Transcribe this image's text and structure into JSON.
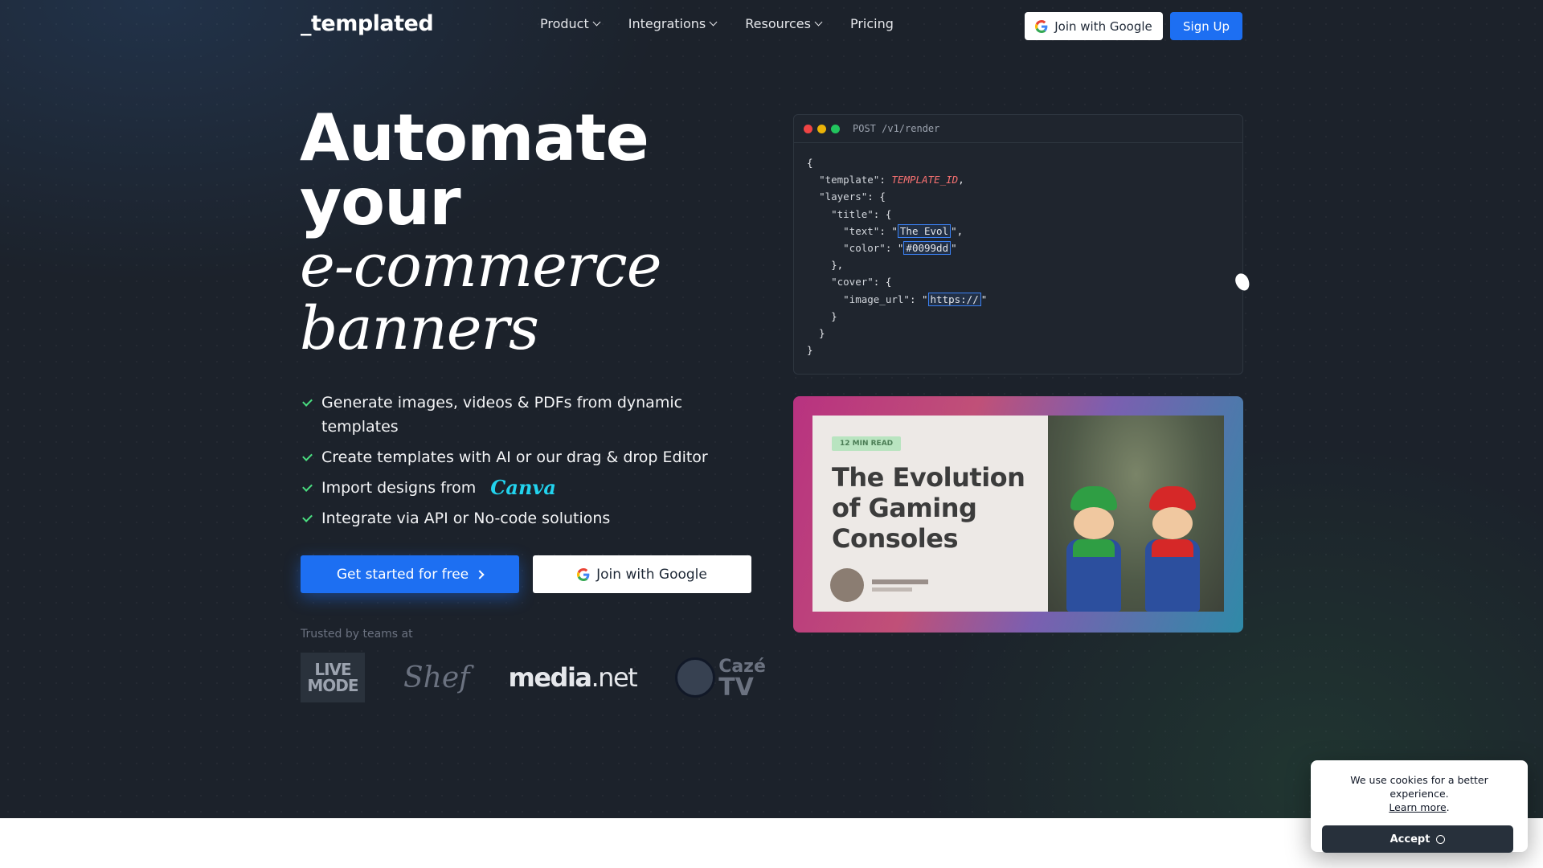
{
  "nav": {
    "logo": "_templated",
    "menu": [
      {
        "label": "Product",
        "has_dropdown": true
      },
      {
        "label": "Integrations",
        "has_dropdown": true
      },
      {
        "label": "Resources",
        "has_dropdown": true
      },
      {
        "label": "Pricing",
        "has_dropdown": false
      }
    ],
    "join_google": "Join with Google",
    "sign_up": "Sign Up"
  },
  "hero": {
    "line1": "Automate",
    "line2": "your",
    "line3": "e-commerce",
    "line4": "banners",
    "features": [
      "Generate images, videos & PDFs from dynamic templates",
      "Create templates with AI or our drag & drop Editor",
      "Import designs from",
      "Integrate via API or No-code solutions"
    ],
    "canva_word": "Canva",
    "cta_primary": "Get started for free",
    "cta_google": "Join with Google",
    "trusted_by": "Trusted by teams at",
    "logos": {
      "live_mode_1": "LIVE",
      "live_mode_2": "MODE",
      "shef": "Shef",
      "media": "media",
      "net": ".net",
      "caze": "Cazé",
      "tv": "TV"
    }
  },
  "code_card": {
    "title": "POST /v1/render",
    "template_value": "TEMPLATE_ID",
    "title_text": "The Evol",
    "color_value": "#0099dd",
    "image_url": "https://"
  },
  "banner": {
    "tag": "12 MIN READ",
    "title": "The Evolution of Gaming Consoles"
  },
  "cookie": {
    "text": "We use cookies for a better experience.",
    "link": "Learn more",
    "accept": "Accept"
  },
  "colors": {
    "accent": "#1d6ff2",
    "hero_bg": "#1c222b",
    "check": "#4ade80",
    "canva": "#22d3ee"
  }
}
